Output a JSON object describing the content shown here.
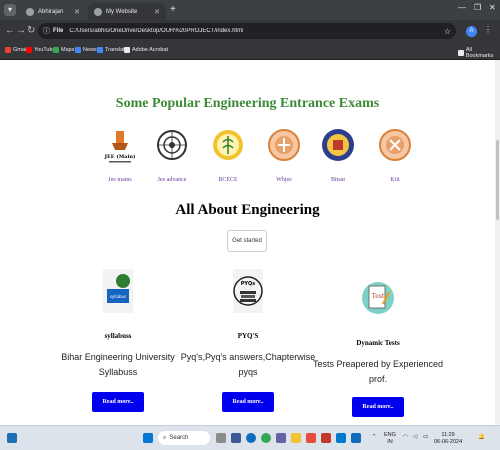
{
  "browser": {
    "tabs": [
      {
        "label": "Abhirajan",
        "active": false
      },
      {
        "label": "My Website",
        "active": true
      }
    ],
    "address": {
      "chip": "File",
      "url": "C:/Users/abhis/OneDrive/Desktop/OUR%20PROJECT/index.html"
    },
    "profile_initial": "A",
    "bookmarks": [
      {
        "label": "Gmail",
        "color": "#ea4335"
      },
      {
        "label": "YouTube",
        "color": "#ff0000"
      },
      {
        "label": "Maps",
        "color": "#34a853"
      },
      {
        "label": "News",
        "color": "#4285f4"
      },
      {
        "label": "Translate",
        "color": "#4285f4"
      },
      {
        "label": "Adobe Acrobat",
        "color": "#e8eaed"
      }
    ],
    "all_bookmarks": "All Bookmarks"
  },
  "page": {
    "exams_heading": "Some Popular Engineering Entrance Exams",
    "exams": [
      {
        "label": "Jee mains",
        "logo_text": "JEE (Main)"
      },
      {
        "label": "Jee advance",
        "logo_text": ""
      },
      {
        "label": "BCECE",
        "logo_text": ""
      },
      {
        "label": "Wbjee",
        "logo_text": ""
      },
      {
        "label": "Bitsat",
        "logo_text": ""
      },
      {
        "label": "Kiit",
        "logo_text": ""
      }
    ],
    "about_heading": "All About Engineering",
    "get_started": "Get started",
    "cards": [
      {
        "title": "syllabuss",
        "desc": "Bihar Engineering University Syllabuss",
        "button": "Read more..",
        "img_text": "syllabus"
      },
      {
        "title": "PYQ'S",
        "desc": "Pyq's,Pyq's answers,Chapterwise pyqs",
        "button": "Read more..",
        "img_text": "PYQs"
      },
      {
        "title": "Dynamic Tests",
        "desc": "Tests Preapered by Experienced prof.",
        "button": "Read more..",
        "img_text": "Test"
      }
    ]
  },
  "taskbar": {
    "search_placeholder": "Search",
    "lang": "ENG",
    "lang2": "IN",
    "time": "11:29",
    "date": "06-06-2024"
  },
  "colors": {
    "heading_green": "#3b8a35",
    "link_purple": "#6a3c9c",
    "button_blue": "#0000ee"
  }
}
